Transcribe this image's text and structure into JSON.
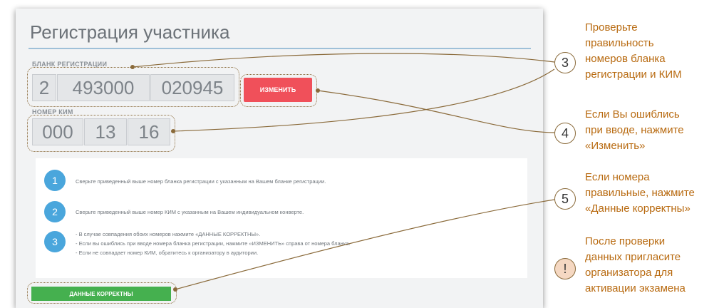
{
  "form": {
    "title": "Регистрация участника",
    "blank_label": "БЛАНК РЕГИСТРАЦИИ",
    "blank_parts": [
      "2",
      "493000",
      "020945"
    ],
    "change_button": "ИЗМЕНИТЬ",
    "kim_label": "НОМЕР КИМ",
    "kim_parts": [
      "000",
      "13",
      "16"
    ],
    "steps": [
      {
        "num": "1",
        "lines": [
          "Сверьте приведенный выше номер бланка регистрации с указанным на Вашем бланке регистрации."
        ]
      },
      {
        "num": "2",
        "lines": [
          "Сверьте приведенный выше номер КИМ с указанным на Вашем индивидуальном конверте."
        ]
      },
      {
        "num": "3",
        "lines": [
          "- В случае совпадения обоих номеров нажмите «ДАННЫЕ КОРРЕКТНЫ».",
          "- Если вы ошиблись при вводе номера бланка регистрации, нажмите «ИЗМЕНИТЬ» справа от номера бланка.",
          "- Если не совпадает номер КИМ, обратитесь к организатору в аудитории."
        ]
      }
    ],
    "ok_button": "ДАННЫЕ КОРРЕКТНЫ"
  },
  "callouts": [
    {
      "num": "3",
      "text": [
        "Проверьте",
        "правильность",
        "номеров бланка",
        "регистрации и КИМ"
      ]
    },
    {
      "num": "4",
      "text": [
        "Если Вы ошиблись",
        "при вводе, нажмите",
        "«Изменить»"
      ]
    },
    {
      "num": "5",
      "text": [
        "Если номера",
        "правильные, нажмите",
        "«Данные корректны»"
      ]
    },
    {
      "num": "!",
      "text": [
        "После проверки",
        "данных пригласите",
        "организатора для",
        "активации экзамена"
      ]
    }
  ],
  "colors": {
    "accent_blue": "#4aa6dc",
    "change_red": "#f0505a",
    "ok_green": "#45b04f",
    "note_orange": "#b86a10"
  }
}
